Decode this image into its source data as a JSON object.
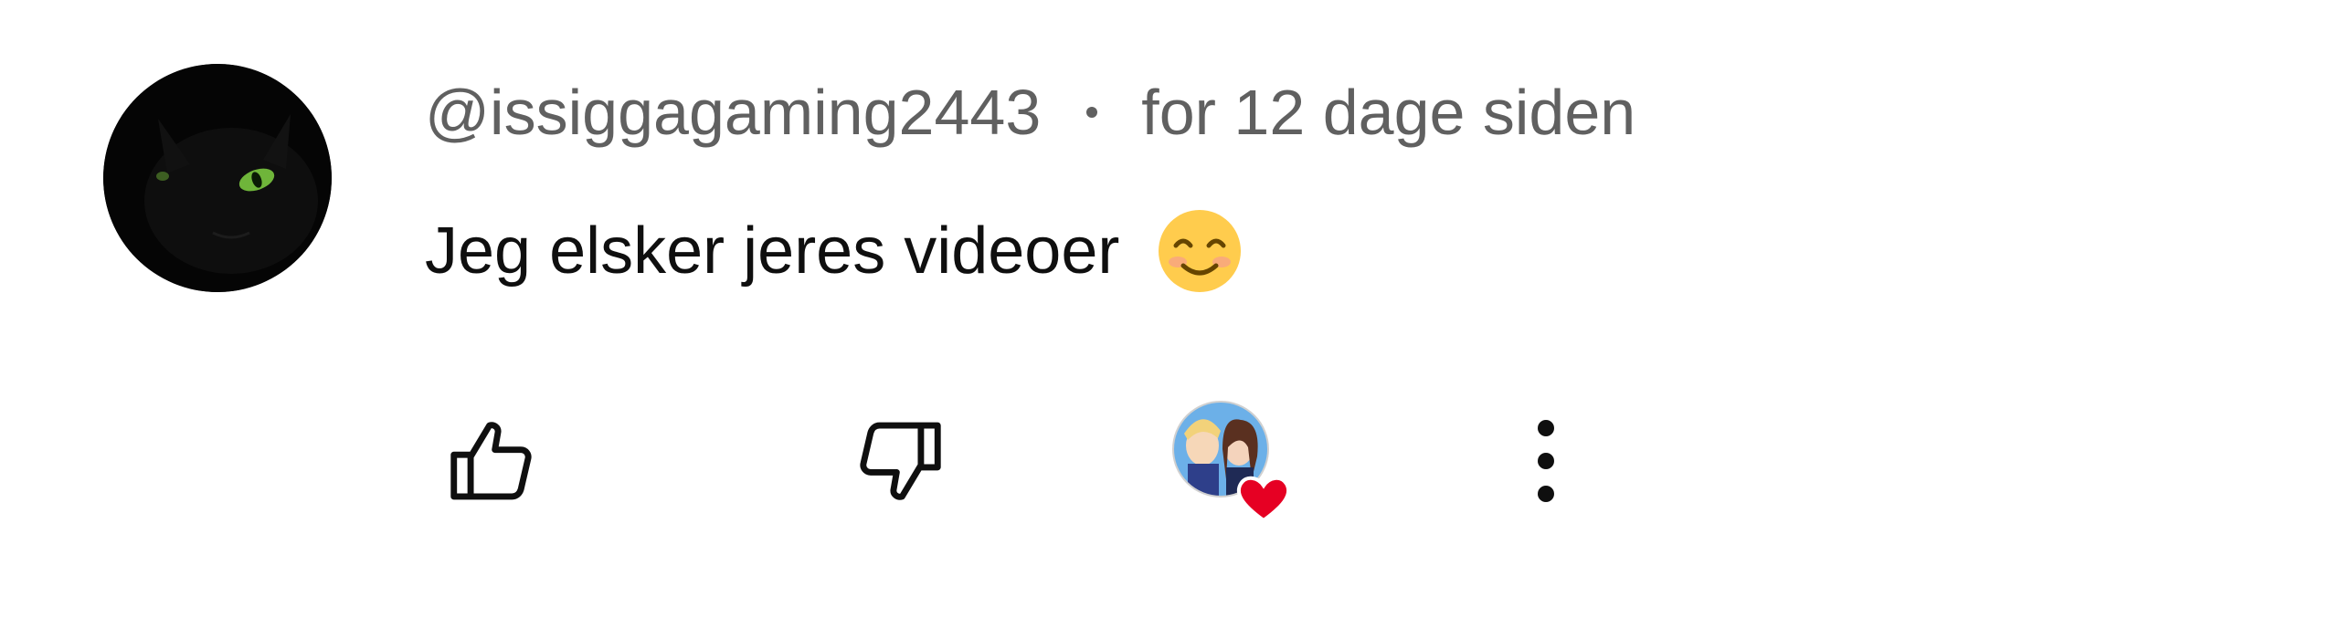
{
  "comment": {
    "author": "@issiggagaming2443",
    "time": "for 12 dage siden",
    "text": "Jeg elsker jeres videoer",
    "emoji": "smiling-face-with-smiling-eyes"
  },
  "actions": {
    "like_icon": "thumbs-up-icon",
    "dislike_icon": "thumbs-down-icon",
    "hearted_icon": "creator-heart-icon",
    "more_icon": "more-vertical-icon"
  },
  "colors": {
    "meta_text": "#606060",
    "body_text": "#0f0f0f",
    "heart": "#e60023"
  }
}
